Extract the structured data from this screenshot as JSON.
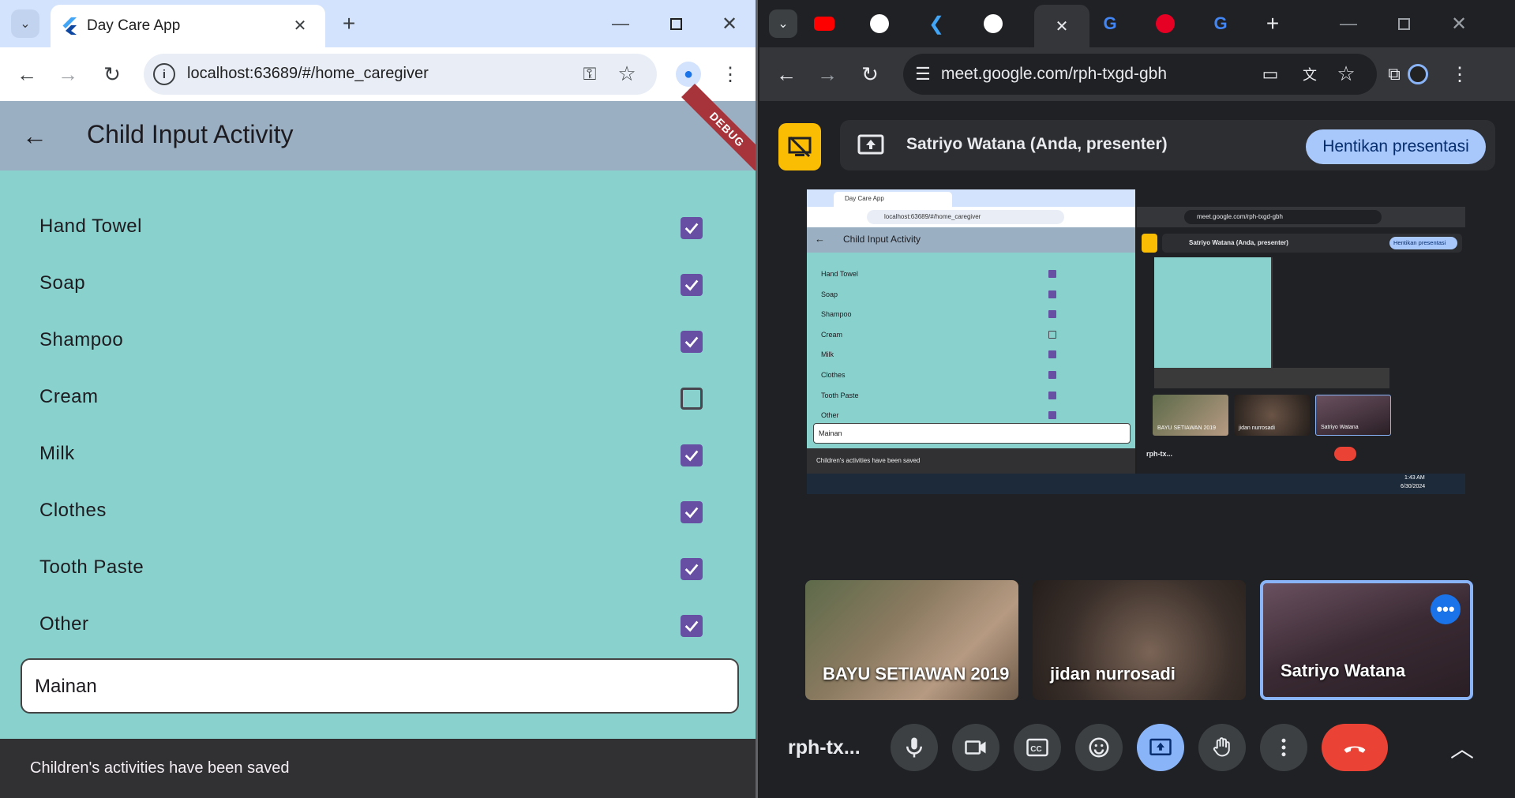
{
  "left_browser": {
    "tab_title": "Day Care App",
    "url": "localhost:63689/#/home_caregiver",
    "window_controls": [
      "minimize-icon",
      "maximize-icon",
      "close-icon"
    ]
  },
  "app": {
    "title": "Child Input Activity",
    "debug_banner": "DEBUG",
    "items": [
      {
        "label": "Hand Towel",
        "checked": true
      },
      {
        "label": "Soap",
        "checked": true
      },
      {
        "label": "Shampoo",
        "checked": true
      },
      {
        "label": "Cream",
        "checked": false
      },
      {
        "label": "Milk",
        "checked": true
      },
      {
        "label": "Clothes",
        "checked": true
      },
      {
        "label": "Tooth Paste",
        "checked": true
      },
      {
        "label": "Other",
        "checked": true
      }
    ],
    "other_input_value": "Mainan",
    "snackbar": "Children's activities have been saved",
    "colors": {
      "appbar": "#9ab0c2",
      "body": "#89d1cc",
      "checkbox": "#6750a4",
      "snackbar": "#313033"
    }
  },
  "right_browser": {
    "url": "meet.google.com/rph-txgd-gbh"
  },
  "meet": {
    "presenter_text": "Satriyo Watana (Anda, presenter)",
    "stop_button": "Hentikan presentasi",
    "participants": [
      {
        "name": "BAYU SETIAWAN 2019"
      },
      {
        "name": "jidan nurrosadi"
      },
      {
        "name": "Satriyo Watana"
      }
    ],
    "meeting_code": "rph-tx...",
    "accent": "#8ab4f8",
    "end_call_color": "#ea4335"
  },
  "shared_screen": {
    "tab_title": "Day Care App",
    "url": "localhost:63689/#/home_caregiver",
    "app_title": "Child Input Activity",
    "items": [
      {
        "label": "Hand Towel",
        "checked": true
      },
      {
        "label": "Soap",
        "checked": true
      },
      {
        "label": "Shampoo",
        "checked": true
      },
      {
        "label": "Cream",
        "checked": false
      },
      {
        "label": "Milk",
        "checked": true
      },
      {
        "label": "Clothes",
        "checked": true
      },
      {
        "label": "Tooth Paste",
        "checked": true
      },
      {
        "label": "Other",
        "checked": true
      }
    ],
    "input_value": "Mainan",
    "snackbar": "Children's activities have been saved",
    "meet_url": "meet.google.com/rph-txgd-gbh",
    "presenter_text": "Satriyo Watana (Anda, presenter)",
    "stop_button": "Hentikan presentasi",
    "participants": [
      "BAYU SETIAWAN 2019",
      "jidan nurrosadi",
      "Satriyo Watana"
    ],
    "meeting_code": "rph-tx...",
    "clock_time": "1:43 AM",
    "clock_date": "6/30/2024"
  }
}
